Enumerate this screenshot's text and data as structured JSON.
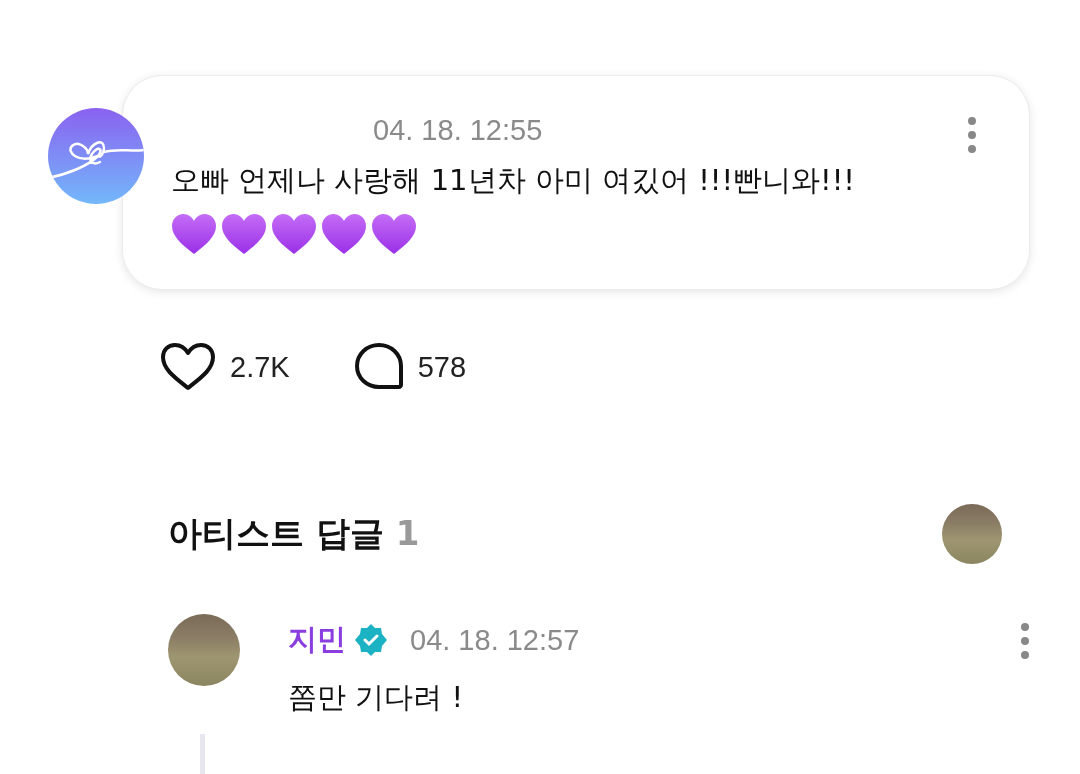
{
  "comment": {
    "time": "04. 18. 12:55",
    "text": "오빠 언제나 사랑해 11년차 아미 여깄어 !!!빤니와!!!",
    "emojis": [
      {
        "kind": "purple_heart"
      },
      {
        "kind": "purple_heart"
      },
      {
        "kind": "purple_heart"
      },
      {
        "kind": "purple_heart"
      },
      {
        "kind": "purple_heart"
      }
    ],
    "likes": "2.7K",
    "replies": "578"
  },
  "artist_replies": {
    "title": "아티스트 답글",
    "count": "1",
    "items": [
      {
        "name": "지민",
        "verified": true,
        "time": "04. 18. 12:57",
        "text": "쫌만 기다려 !"
      }
    ]
  }
}
